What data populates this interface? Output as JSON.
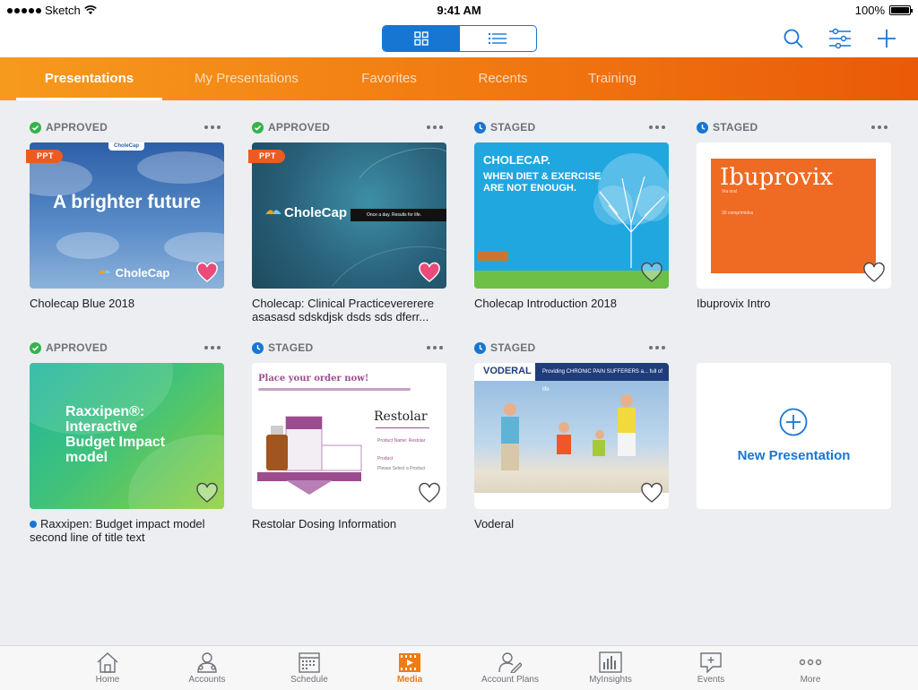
{
  "status_bar": {
    "carrier": "Sketch",
    "time": "9:41 AM",
    "battery": "100%"
  },
  "toolbar": {
    "view_toggle": {
      "grid_icon": "grid-view-icon",
      "list_icon": "list-view-icon",
      "selected": "grid"
    },
    "icons": [
      "search-icon",
      "filter-sliders-icon",
      "add-icon"
    ]
  },
  "tabs": [
    {
      "label": "Presentations",
      "active": true
    },
    {
      "label": "My Presentations",
      "active": false
    },
    {
      "label": "Favorites",
      "active": false
    },
    {
      "label": "Recents",
      "active": false
    },
    {
      "label": "Training",
      "active": false
    }
  ],
  "cards": [
    {
      "status": "APPROVED",
      "status_icon": "check-circle-icon",
      "title": "Cholecap Blue 2018",
      "badge": "PPT",
      "favorited": true,
      "thumb": {
        "headline": "A brighter future",
        "brand": "CholeCap",
        "top_brand": "CholeCap"
      }
    },
    {
      "status": "APPROVED",
      "status_icon": "check-circle-icon",
      "title": "Cholecap: Clinical Practicevererere asasasd sdskdjsk  dsds sds dferr...",
      "badge": "PPT",
      "favorited": true,
      "thumb": {
        "brand": "CholeCap",
        "tagline": "Once a day. Results for life."
      }
    },
    {
      "status": "STAGED",
      "status_icon": "clock-icon",
      "title": "Cholecap Introduction 2018",
      "favorited": false,
      "thumb": {
        "headline": "CHOLECAP.",
        "subline_1": "WHEN DIET & EXERCISE",
        "subline_2": "ARE NOT ENOUGH."
      }
    },
    {
      "status": "STAGED",
      "status_icon": "clock-icon",
      "title": "Ibuprovix Intro",
      "favorited": false,
      "thumb": {
        "name": "Ibuprovix",
        "small_1": "Via oral",
        "small_2": "30 comprimidos"
      }
    },
    {
      "status": "APPROVED",
      "status_icon": "check-circle-icon",
      "title_line_1": "Raxxipen: Budget impact model",
      "title_line_2": "second line of title text",
      "favorited": false,
      "unread": true,
      "thumb": {
        "line_1": "Raxxipen®:",
        "line_2": "Interactive",
        "line_3": "Budget Impact",
        "line_4": "model"
      }
    },
    {
      "status": "STAGED",
      "status_icon": "clock-icon",
      "title": "Restolar Dosing Information",
      "favorited": false,
      "thumb": {
        "header": "Place your order now!",
        "brand": "Restolar",
        "field_1": "Product Name: Restolar",
        "field_2": "Product",
        "field_3": "Please Select a Product"
      }
    },
    {
      "status": "STAGED",
      "status_icon": "clock-icon",
      "title": "Voderal",
      "favorited": false,
      "thumb": {
        "logo": "VODERAL",
        "banner": "Providing CHRONIC PAIN SUFFERERS a... full of life"
      }
    }
  ],
  "new_presentation": {
    "label": "New Presentation",
    "icon": "plus-circle-icon"
  },
  "bottom_tabs": [
    {
      "label": "Home",
      "icon": "home-icon",
      "active": false
    },
    {
      "label": "Accounts",
      "icon": "accounts-icon",
      "active": false
    },
    {
      "label": "Schedule",
      "icon": "calendar-icon",
      "active": false
    },
    {
      "label": "Media",
      "icon": "media-icon",
      "active": true
    },
    {
      "label": "Account Plans",
      "icon": "account-plans-icon",
      "active": false
    },
    {
      "label": "MyInsights",
      "icon": "insights-icon",
      "active": false
    },
    {
      "label": "Events",
      "icon": "events-icon",
      "active": false
    },
    {
      "label": "More",
      "icon": "more-icon",
      "active": false
    }
  ],
  "colors": {
    "accent_blue": "#1776d2",
    "tab_orange_start": "#f69a1d",
    "tab_orange_end": "#ea5a08",
    "approved_green": "#34b34a",
    "staged_blue": "#1776d2",
    "favorite_pink": "#ea4b7a"
  }
}
